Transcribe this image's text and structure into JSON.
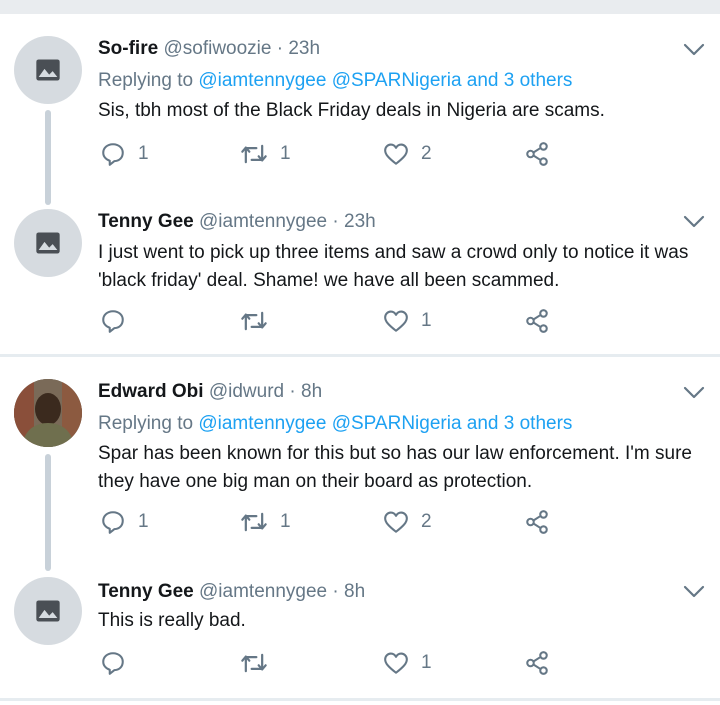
{
  "tweets": [
    {
      "name": "So-fire",
      "handle": "@sofiwoozie",
      "time": "23h",
      "reply_prefix": "Replying to",
      "reply_mentions": "@iamtennygee @SPARNigeria and 3 others",
      "text": "Sis, tbh most of the Black Friday deals in Nigeria are scams.",
      "replies": "1",
      "retweets": "1",
      "likes": "2",
      "avatar": "image-placeholder-icon"
    },
    {
      "name": "Tenny Gee",
      "handle": "@iamtennygee",
      "time": "23h",
      "text": "I just went to pick up three items and saw a crowd only to notice it was 'black friday' deal. Shame! we have all been scammed.",
      "replies": "",
      "retweets": "",
      "likes": "1",
      "avatar": "image-placeholder-icon"
    },
    {
      "name": "Edward Obi",
      "handle": "@idwurd",
      "time": "8h",
      "reply_prefix": "Replying to",
      "reply_mentions": "@iamtennygee @SPARNigeria and 3 others",
      "text": "Spar has been known for this but so has our law enforcement. I'm sure they have one big man on their board as protection.",
      "replies": "1",
      "retweets": "1",
      "likes": "2",
      "avatar": "profile-photo"
    },
    {
      "name": "Tenny Gee",
      "handle": "@iamtennygee",
      "time": "8h",
      "text": "This is really bad.",
      "replies": "",
      "retweets": "",
      "likes": "1",
      "avatar": "image-placeholder-icon"
    }
  ],
  "separator": "·",
  "colors": {
    "accent": "#1da1f2",
    "secondary": "#657786",
    "text": "#14171a",
    "thread_line": "#c8d1d9"
  }
}
